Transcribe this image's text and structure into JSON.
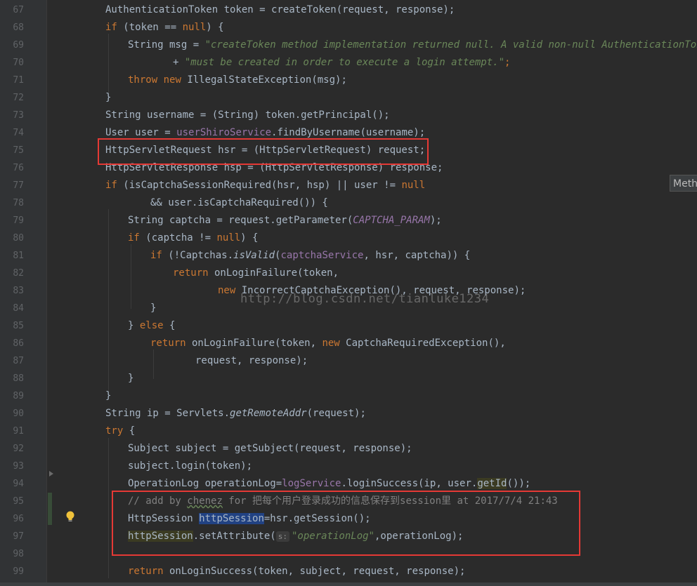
{
  "gutter": {
    "line_numbers": [
      "67",
      "68",
      "69",
      "70",
      "71",
      "72",
      "73",
      "74",
      "75",
      "76",
      "77",
      "78",
      "79",
      "80",
      "81",
      "82",
      "83",
      "84",
      "85",
      "86",
      "87",
      "88",
      "89",
      "90",
      "91",
      "92",
      "93",
      "94",
      "95",
      "96",
      "97",
      "98",
      "99"
    ]
  },
  "code": {
    "l67": {
      "t1": "AuthenticationToken token = createToken(request, response);"
    },
    "l68": {
      "kw1": "if",
      "t1": " (token == ",
      "kw2": "null",
      "t2": ") {"
    },
    "l69": {
      "t1": "String msg = ",
      "s1": "\"createToken method implementation returned null. A valid non-null AuthenticationToken \""
    },
    "l70": {
      "t1": "+ ",
      "s1": "\"must be created in order to execute a login attempt.\"",
      "t2": ";"
    },
    "l71": {
      "kw1": "throw",
      "t1": " ",
      "kw2": "new",
      "t2": " IllegalStateException(msg);"
    },
    "l72": {
      "t1": "}"
    },
    "l73": {
      "t1": "String username = (String) token.getPrincipal();"
    },
    "l74": {
      "t1": "User user = ",
      "f1": "userShiroService",
      "t2": ".findByUsername(username);"
    },
    "l75": {
      "t1": "HttpServletRequest hsr = (HttpServletRequest) request;"
    },
    "l76": {
      "t1": "HttpServletResponse hsp = (HttpServletResponse) response;"
    },
    "l77": {
      "kw1": "if",
      "t1": " (isCaptchaSessionRequired(hsr, hsp) || user != ",
      "kw2": "null"
    },
    "l78": {
      "t1": "&& user.isCaptchaRequired()) {"
    },
    "l79": {
      "t1": "String captcha = request.getParameter(",
      "c1": "CAPTCHA_PARAM",
      "t2": ");"
    },
    "l80": {
      "kw1": "if",
      "t1": " (captcha != ",
      "kw2": "null",
      "t2": ") {"
    },
    "l81": {
      "kw1": "if",
      "t1": " (!Captchas.",
      "m1": "isValid",
      "t2": "(",
      "f1": "captchaService",
      "t3": ", hsr, captcha)) {"
    },
    "l82": {
      "kw1": "return",
      "t1": " onLoginFailure(token,"
    },
    "l83": {
      "kw1": "new",
      "t1": " IncorrectCaptchaException(), request, response);"
    },
    "l84": {
      "t1": "}"
    },
    "l85": {
      "t1": "} ",
      "kw1": "else",
      "t2": " {"
    },
    "l86": {
      "kw1": "return",
      "t1": " onLoginFailure(token, ",
      "kw2": "new",
      "t2": " CaptchaRequiredException(),"
    },
    "l87": {
      "t1": "request, response);"
    },
    "l88": {
      "t1": "}"
    },
    "l89": {
      "t1": "}"
    },
    "l90": {
      "t1": "String ip = Servlets.",
      "m1": "getRemoteAddr",
      "t2": "(request);"
    },
    "l91": {
      "kw1": "try",
      "t1": " {"
    },
    "l92": {
      "t1": "Subject subject = getSubject(request, response);"
    },
    "l93": {
      "t1": "subject.login(token);"
    },
    "l94": {
      "t1": "OperationLog operationLog=",
      "f1": "logService",
      "t2": ".loginSuccess(ip, user.",
      "h1": "getId",
      "t3": "());"
    },
    "l95": {
      "c1": "// add by ",
      "c2": "chenez",
      "c3": " for 把每个用户登录成功的信息保存到session里 at 2017/7/4 21:43"
    },
    "l96": {
      "t1": "HttpSession ",
      "v1": "httpSession",
      "t2": "=hsr.getSession();"
    },
    "l97": {
      "v1": "httpSession",
      "t1": ".setAttribute(",
      "hint": "s:",
      "s1": "\"operationLog\"",
      "t2": ",operationLog);"
    },
    "l98": {
      "t1": ""
    },
    "l99": {
      "kw1": "return",
      "t1": " onLoginSuccess(token, subject, request, response);"
    }
  },
  "tooltip": {
    "text": "Meth"
  },
  "watermark": {
    "text": "http://blog.csdn.net/tianluke1234"
  },
  "colors": {
    "background": "#2b2b2b",
    "keyword": "#cc7832",
    "string": "#6a8759",
    "field": "#9876aa",
    "comment": "#808080",
    "highlight_box": "#e53935"
  },
  "icons": {
    "bulb": "lightbulb-icon",
    "fold": "fold-arrow-icon"
  }
}
